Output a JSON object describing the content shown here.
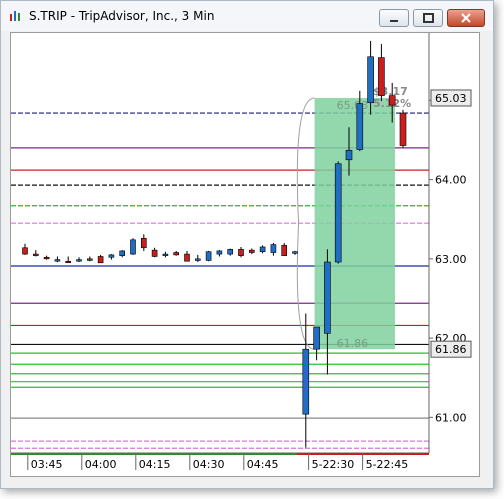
{
  "window": {
    "title": "S.TRIP - TripAdvisor, Inc., 3 Min"
  },
  "price_labels": {
    "last": "65.03",
    "current": "61.86"
  },
  "annotations": {
    "gain": "$3.17",
    "gain_pct": "5.12%",
    "box_top": "65.03",
    "box_bottom": "61.86"
  },
  "colors": {
    "up": "#1e6fc3",
    "down": "#c81e1e",
    "box": "#7fd19e",
    "highlight": "#2e8b2e"
  },
  "chart_data": {
    "type": "candlestick",
    "title": "",
    "xlabel": "",
    "ylabel": "",
    "ylim": [
      60.55,
      65.85
    ],
    "yticks": [
      "65.00",
      "64.00",
      "63.00",
      "62.00",
      "61.00"
    ],
    "ytick_values": [
      65.0,
      64.0,
      63.0,
      62.0,
      61.0
    ],
    "xtick_labels": [
      "03:45",
      "04:00",
      "04:15",
      "04:30",
      "04:45",
      "5-22:30",
      "5-22:45"
    ],
    "xtick_index": [
      1,
      6,
      11,
      16,
      21,
      27,
      32
    ],
    "candles": [
      {
        "o": 63.14,
        "h": 63.19,
        "l": 63.05,
        "c": 63.06
      },
      {
        "o": 63.06,
        "h": 63.11,
        "l": 63.03,
        "c": 63.05
      },
      {
        "o": 63.02,
        "h": 63.04,
        "l": 62.99,
        "c": 63.0
      },
      {
        "o": 62.98,
        "h": 63.03,
        "l": 62.96,
        "c": 62.99
      },
      {
        "o": 62.97,
        "h": 63.03,
        "l": 62.96,
        "c": 62.96
      },
      {
        "o": 62.98,
        "h": 63.02,
        "l": 62.96,
        "c": 62.99
      },
      {
        "o": 63.0,
        "h": 63.03,
        "l": 62.97,
        "c": 62.99
      },
      {
        "o": 63.03,
        "h": 63.05,
        "l": 62.95,
        "c": 62.95
      },
      {
        "o": 63.02,
        "h": 63.06,
        "l": 62.99,
        "c": 63.05
      },
      {
        "o": 63.04,
        "h": 63.11,
        "l": 63.02,
        "c": 63.1
      },
      {
        "o": 63.06,
        "h": 63.26,
        "l": 63.05,
        "c": 63.24
      },
      {
        "o": 63.26,
        "h": 63.31,
        "l": 63.1,
        "c": 63.14
      },
      {
        "o": 63.11,
        "h": 63.14,
        "l": 63.02,
        "c": 63.03
      },
      {
        "o": 63.05,
        "h": 63.09,
        "l": 63.02,
        "c": 63.06
      },
      {
        "o": 63.08,
        "h": 63.1,
        "l": 63.04,
        "c": 63.05
      },
      {
        "o": 63.06,
        "h": 63.1,
        "l": 62.97,
        "c": 62.97
      },
      {
        "o": 62.98,
        "h": 63.05,
        "l": 62.96,
        "c": 63.0
      },
      {
        "o": 62.98,
        "h": 63.1,
        "l": 62.97,
        "c": 63.09
      },
      {
        "o": 63.06,
        "h": 63.11,
        "l": 63.03,
        "c": 63.1
      },
      {
        "o": 63.06,
        "h": 63.13,
        "l": 63.04,
        "c": 63.12
      },
      {
        "o": 63.12,
        "h": 63.15,
        "l": 63.02,
        "c": 63.04
      },
      {
        "o": 63.11,
        "h": 63.13,
        "l": 63.06,
        "c": 63.08
      },
      {
        "o": 63.09,
        "h": 63.17,
        "l": 63.07,
        "c": 63.15
      },
      {
        "o": 63.08,
        "h": 63.2,
        "l": 63.04,
        "c": 63.18
      },
      {
        "o": 63.17,
        "h": 63.2,
        "l": 63.04,
        "c": 63.04
      },
      {
        "o": 63.07,
        "h": 63.1,
        "l": 63.05,
        "c": 63.09
      },
      {
        "o": 61.04,
        "h": 62.31,
        "l": 60.62,
        "c": 61.86
      },
      {
        "o": 61.86,
        "h": 62.14,
        "l": 61.72,
        "c": 62.14
      },
      {
        "o": 62.06,
        "h": 63.12,
        "l": 61.54,
        "c": 62.96
      },
      {
        "o": 62.96,
        "h": 64.23,
        "l": 62.94,
        "c": 64.2
      },
      {
        "o": 64.25,
        "h": 64.66,
        "l": 64.05,
        "c": 64.37
      },
      {
        "o": 64.38,
        "h": 65.12,
        "l": 64.36,
        "c": 64.96
      },
      {
        "o": 64.97,
        "h": 65.75,
        "l": 64.82,
        "c": 65.55
      },
      {
        "o": 65.54,
        "h": 65.71,
        "l": 64.99,
        "c": 65.06
      },
      {
        "o": 65.06,
        "h": 65.22,
        "l": 64.72,
        "c": 64.94
      },
      {
        "o": 64.84,
        "h": 64.88,
        "l": 64.4,
        "c": 64.43
      }
    ],
    "hlines": [
      {
        "y": 64.84,
        "color": "#1a1a7a",
        "dash": true
      },
      {
        "y": 64.4,
        "color": "#7a2a8a",
        "dash": false
      },
      {
        "y": 64.12,
        "color": "#c02020",
        "dash": false
      },
      {
        "y": 63.93,
        "color": "#111111",
        "dash": true
      },
      {
        "y": 63.67,
        "color": "#22bb22",
        "dash": true
      },
      {
        "y": 63.45,
        "color": "#e070e0",
        "dash": true
      },
      {
        "y": 62.91,
        "color": "#1a2aaa",
        "dash": false
      },
      {
        "y": 62.44,
        "color": "#7a2a8a",
        "dash": false
      },
      {
        "y": 62.16,
        "color": "#c02020",
        "dash": false
      },
      {
        "y": 61.92,
        "color": "#111111",
        "dash": false
      },
      {
        "y": 61.81,
        "color": "#2bbf2b",
        "dash": false
      },
      {
        "y": 61.67,
        "color": "#2bbf2b",
        "dash": false
      },
      {
        "y": 61.55,
        "color": "#2bbf2b",
        "dash": false
      },
      {
        "y": 61.45,
        "color": "#2bbf2b",
        "dash": false
      },
      {
        "y": 61.38,
        "color": "#2bbf2b",
        "dash": false
      },
      {
        "y": 60.99,
        "color": "#888888",
        "dash": false
      },
      {
        "y": 60.7,
        "color": "#e070e0",
        "dash": true
      },
      {
        "y": 60.61,
        "color": "#e070e0",
        "dash": true
      }
    ]
  }
}
